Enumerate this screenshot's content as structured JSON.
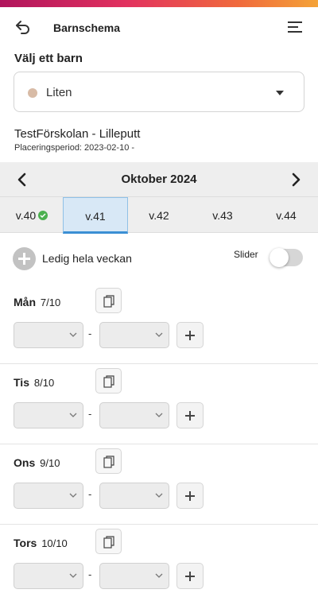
{
  "colors": {
    "accent_gradient": [
      "#b0145c",
      "#e2325f",
      "#f06a3c",
      "#f4a338"
    ],
    "selected_week": "#3b8fd4",
    "check": "#4bb04f",
    "child_dot": "#d8bba6"
  },
  "header": {
    "title": "Barnschema",
    "back_icon": "arrow-back-icon",
    "menu_icon": "hamburger-menu-icon"
  },
  "child_picker": {
    "label": "Välj ett barn",
    "selected": "Liten"
  },
  "placement": {
    "school": "TestFörskolan - Lilleputt",
    "period": "Placeringsperiod: 2023-02-10 -"
  },
  "calendar": {
    "month": "Oktober 2024",
    "weeks": [
      {
        "label": "v.40",
        "completed": true
      },
      {
        "label": "v.41",
        "selected": true
      },
      {
        "label": "v.42"
      },
      {
        "label": "v.43"
      },
      {
        "label": "v.44"
      }
    ]
  },
  "actions": {
    "free_week_label": "Ledig hela veckan",
    "slider_label": "Slider",
    "slider_on": false
  },
  "days": [
    {
      "name": "Mån",
      "date": "7/10",
      "from": "",
      "to": ""
    },
    {
      "name": "Tis",
      "date": "8/10",
      "from": "",
      "to": ""
    },
    {
      "name": "Ons",
      "date": "9/10",
      "from": "",
      "to": ""
    },
    {
      "name": "Tors",
      "date": "10/10",
      "from": "",
      "to": ""
    }
  ],
  "separator": "-"
}
